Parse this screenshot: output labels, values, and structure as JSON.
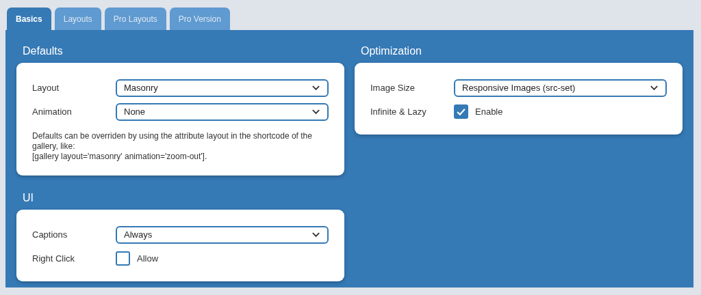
{
  "tabs": [
    {
      "label": "Basics",
      "selected": true
    },
    {
      "label": "Layouts",
      "selected": false
    },
    {
      "label": "Pro Layouts",
      "selected": false
    },
    {
      "label": "Pro Version",
      "selected": false
    }
  ],
  "columns": [
    {
      "sections": [
        {
          "title": "Defaults",
          "rows": [
            {
              "kind": "select",
              "label": "Layout",
              "value": "Masonry"
            },
            {
              "kind": "select",
              "label": "Animation",
              "value": "None"
            },
            {
              "kind": "note",
              "lines": [
                "Defaults can be overriden by using the attribute layout in the shortcode of the gallery, like:",
                "[gallery layout='masonry' animation='zoom-out']."
              ]
            }
          ]
        },
        {
          "title": "UI",
          "rows": [
            {
              "kind": "select",
              "label": "Captions",
              "value": "Always"
            },
            {
              "kind": "checkbox",
              "label": "Right Click",
              "option": "Allow",
              "checked": false
            }
          ]
        }
      ]
    },
    {
      "sections": [
        {
          "title": "Optimization",
          "rows": [
            {
              "kind": "select",
              "label": "Image Size",
              "value": "Responsive Images (src-set)"
            },
            {
              "kind": "checkbox",
              "label": "Infinite & Lazy",
              "option": "Enable",
              "checked": true
            }
          ]
        }
      ]
    }
  ]
}
